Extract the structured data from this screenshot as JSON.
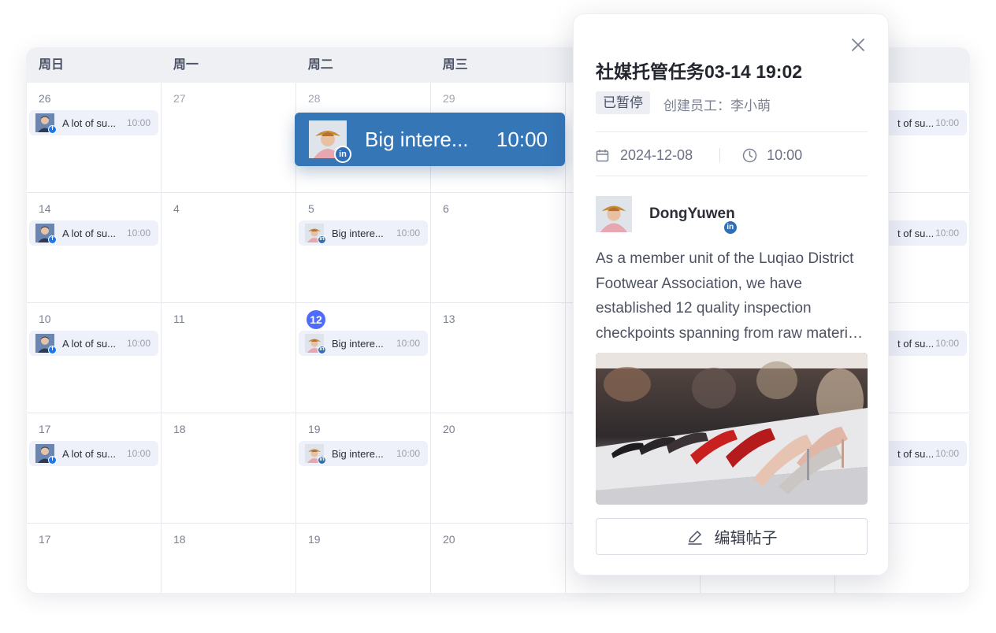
{
  "weekdays": [
    "周日",
    "周一",
    "周二",
    "周三",
    "",
    "",
    ""
  ],
  "days": [
    [
      "26",
      "27",
      "28",
      "29",
      "",
      "",
      ""
    ],
    [
      "14",
      "4",
      "5",
      "6",
      "",
      "",
      ""
    ],
    [
      "10",
      "11",
      "12",
      "13",
      "",
      "",
      ""
    ],
    [
      "17",
      "18",
      "19",
      "20",
      "",
      "",
      ""
    ],
    [
      "17",
      "18",
      "19",
      "20",
      "",
      "",
      ""
    ]
  ],
  "today_day": "12",
  "event_fb": {
    "title": "A lot of su...",
    "time": "10:00",
    "partial_title": "t of su..."
  },
  "event_li": {
    "title": "Big intere...",
    "time": "10:00"
  },
  "drag_event": {
    "title": "Big intere...",
    "time": "10:00"
  },
  "popup": {
    "title": "社媒托管任务03-14 19:02",
    "status": "已暂停",
    "creator_label": "创建员工：",
    "creator_name": "李小萌",
    "date": "2024-12-08",
    "time": "10:00",
    "author": "DongYuwen",
    "body": "As a member unit of the Luqiao District Footwear Association, we have established 12 quality inspection checkpoints spanning from raw materials to finished products.",
    "edit_label": "编辑帖子"
  },
  "colors": {
    "accent": "#4d6bfe",
    "linkedin": "#2d6fb8",
    "facebook": "#1877f2",
    "drag_bg": "#3576b7",
    "event_bg": "#eef1fa"
  }
}
